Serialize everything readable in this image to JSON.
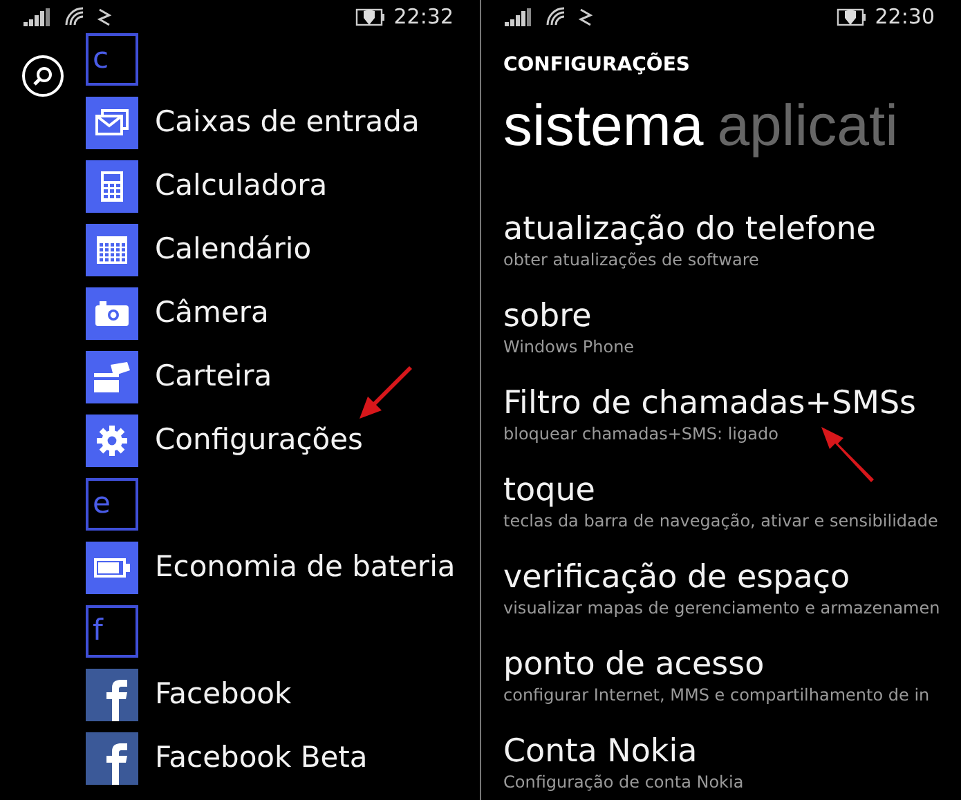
{
  "left_screen": {
    "status_bar": {
      "time": "22:32"
    },
    "app_list": [
      {
        "kind": "letter",
        "label": "c"
      },
      {
        "kind": "mail",
        "label": "Caixas de entrada"
      },
      {
        "kind": "calculator",
        "label": "Calculadora"
      },
      {
        "kind": "calendar",
        "label": "Calendário"
      },
      {
        "kind": "camera",
        "label": "Câmera"
      },
      {
        "kind": "wallet",
        "label": "Carteira"
      },
      {
        "kind": "gear",
        "label": "Configurações"
      },
      {
        "kind": "letter",
        "label": "e"
      },
      {
        "kind": "battery",
        "label": "Economia de bateria"
      },
      {
        "kind": "letter",
        "label": "f"
      },
      {
        "kind": "facebook",
        "label": "Facebook"
      },
      {
        "kind": "facebook",
        "label": "Facebook Beta"
      }
    ]
  },
  "right_screen": {
    "status_bar": {
      "time": "22:30"
    },
    "header": "CONFIGURAÇÕES",
    "pivots": [
      {
        "label": "sistema",
        "selected": true
      },
      {
        "label": "aplicati",
        "selected": false
      }
    ],
    "settings": [
      {
        "title": "atualização do telefone",
        "subtitle": "obter atualizações de software"
      },
      {
        "title": "sobre",
        "subtitle": "Windows Phone"
      },
      {
        "title": "Filtro de chamadas+SMSs",
        "subtitle": "bloquear chamadas+SMS: ligado"
      },
      {
        "title": "toque",
        "subtitle": "teclas da barra de navegação, ativar e sensibilidade"
      },
      {
        "title": "verificação de espaço",
        "subtitle": "visualizar mapas de gerenciamento e armazenamen"
      },
      {
        "title": "ponto de acesso",
        "subtitle": "configurar Internet, MMS e compartilhamento de in"
      },
      {
        "title": "Conta Nokia",
        "subtitle": "Configuração de conta Nokia"
      }
    ]
  }
}
